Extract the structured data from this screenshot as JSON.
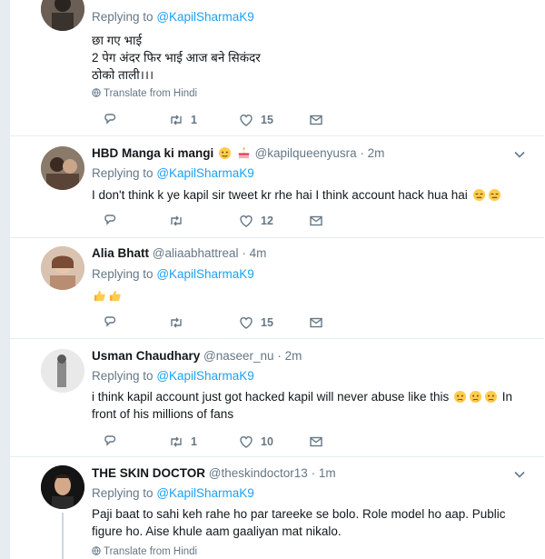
{
  "tweets": [
    {
      "display_name": "",
      "screen_name": "",
      "time": "",
      "replying_label": "Replying to",
      "replying_to": "@KapilSharmaK9",
      "text_lines": [
        "छा गए भाई",
        "2 पेग अंदर फिर भाई आज बने सिकंदर",
        "ठोको ताली।।।"
      ],
      "translate": "Translate from Hindi",
      "retweets": "1",
      "likes": "15"
    },
    {
      "display_name": "HBD Manga ki mangi",
      "screen_name": "@kapilqueenyusra",
      "time": "2m",
      "replying_label": "Replying to",
      "replying_to": "@KapilSharmaK9",
      "text_lines": [
        "I don't think k ye kapil sir tweet kr rhe hai I think account hack hua hai"
      ],
      "retweets": "",
      "likes": "12"
    },
    {
      "display_name": "Alia Bhatt",
      "screen_name": "@aliaabhattreal",
      "time": "4m",
      "replying_label": "Replying to",
      "replying_to": "@KapilSharmaK9",
      "text_lines": [
        ""
      ],
      "retweets": "",
      "likes": "15"
    },
    {
      "display_name": "Usman Chaudhary",
      "screen_name": "@naseer_nu",
      "time": "2m",
      "replying_label": "Replying to",
      "replying_to": "@KapilSharmaK9",
      "text_lines": [
        "i think kapil account  just got hacked kapil will never abuse like this",
        "front of his millions  of fans"
      ],
      "text_tail": "In",
      "retweets": "1",
      "likes": "10"
    },
    {
      "display_name": "THE SKIN DOCTOR",
      "screen_name": "@theskindoctor13",
      "time": "1m",
      "replying_label": "Replying to",
      "replying_to": "@KapilSharmaK9",
      "text_lines": [
        "Paji baat to sahi keh rahe ho par tareeke se bolo. Role model ho aap. Public",
        "figure ho. Aise khule aam gaaliyan mat nikalo."
      ],
      "translate": "Translate from Hindi"
    }
  ],
  "time_separator": "·",
  "colors": {
    "link": "#1da1f2",
    "secondary": "#657786",
    "border": "#e6ecf0"
  }
}
